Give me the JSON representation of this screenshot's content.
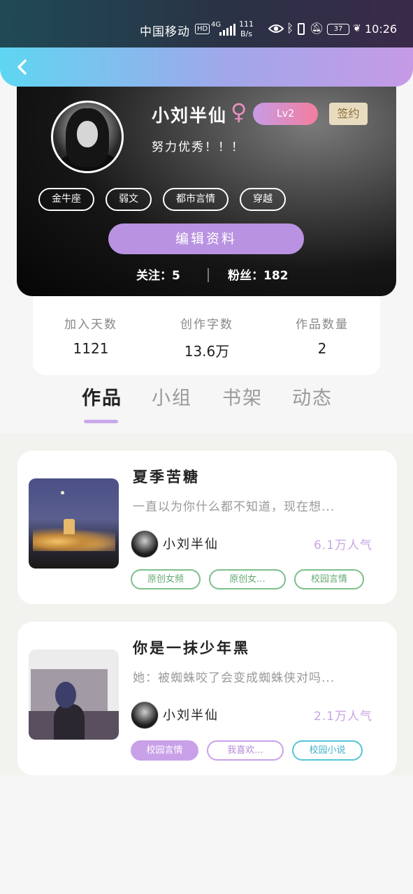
{
  "status_bar": {
    "carrier": "中国移动",
    "hd": "HD",
    "network": "4G",
    "speed_value": "111",
    "speed_unit": "B/s",
    "battery": "37",
    "time": "10:26"
  },
  "profile": {
    "username": "小刘半仙",
    "gender_symbol": "♀",
    "level": "Lv2",
    "sign_label": "签约",
    "bio": "努力优秀！！！",
    "tags": [
      "金牛座",
      "弱文",
      "都市言情",
      "穿越"
    ],
    "edit_button": "编辑资料",
    "following": "关注：5",
    "followers": "粉丝：182"
  },
  "stats": [
    {
      "label": "加入天数",
      "value": "1121"
    },
    {
      "label": "创作字数",
      "value": "13.6万"
    },
    {
      "label": "作品数量",
      "value": "2"
    }
  ],
  "tabs": [
    "作品",
    "小组",
    "书架",
    "动态"
  ],
  "active_tab": "作品",
  "works": [
    {
      "title": "夏季苦糖",
      "description": "一直以为你什么都不知道，现在想...",
      "author": "小刘半仙",
      "popularity": "6.1万人气",
      "tags": [
        "原创女频",
        "原创女...",
        "校园言情"
      ]
    },
    {
      "title": "你是一抹少年黑",
      "description": "她：被蜘蛛咬了会变成蜘蛛侠对吗...",
      "author": "小刘半仙",
      "popularity": "2.1万人气",
      "tags": [
        "校园言情",
        "我喜欢...",
        "校园小说"
      ]
    }
  ],
  "colors": {
    "header_gradient_start": "#5ed6f2",
    "header_gradient_end": "#c69ae6",
    "accent_purple": "#b993e2",
    "popularity_purple": "#c8a5e6",
    "tag_green": "#7cc08a",
    "tag_teal": "#55c5d8"
  }
}
